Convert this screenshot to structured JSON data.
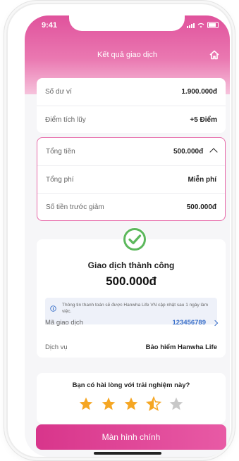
{
  "status": {
    "time": "9:41"
  },
  "header": {
    "title": "Kết quả giao dịch",
    "home_icon": "home-icon"
  },
  "balance_card": {
    "rows": [
      {
        "label": "Số dư ví",
        "value": "1.900.000đ"
      },
      {
        "label": "Điểm tích lũy",
        "value": "+5 Điểm"
      }
    ]
  },
  "total_card": {
    "total_label": "Tổng tiền",
    "total_value": "500.000đ",
    "fee_label": "Tổng phí",
    "fee_value": "Miễn phí",
    "before_label": "Số tiền trước giảm",
    "before_value": "500.000đ"
  },
  "result": {
    "icon": "check-circle-icon",
    "title": "Giao dịch thành công",
    "amount": "500.000đ",
    "info_text": "Thông tin thanh toán sẽ được Hanwha Life VN cập nhật sau 1 ngày làm việc.",
    "txid_label": "Mã giao dịch",
    "txid_value": "123456789",
    "service_label": "Dịch vụ",
    "service_value": "Bảo hiểm Hanwha Life"
  },
  "rating": {
    "question": "Bạn có hài lòng với trải nghiệm này?",
    "value": 3.5,
    "max": 5,
    "color_on": "#f5a623",
    "color_off": "#c8c8c8"
  },
  "actions": {
    "main_button": "Màn hình chính"
  },
  "colors": {
    "brand": "#e0529c",
    "link": "#3a70c9",
    "success": "#5cb85c"
  }
}
